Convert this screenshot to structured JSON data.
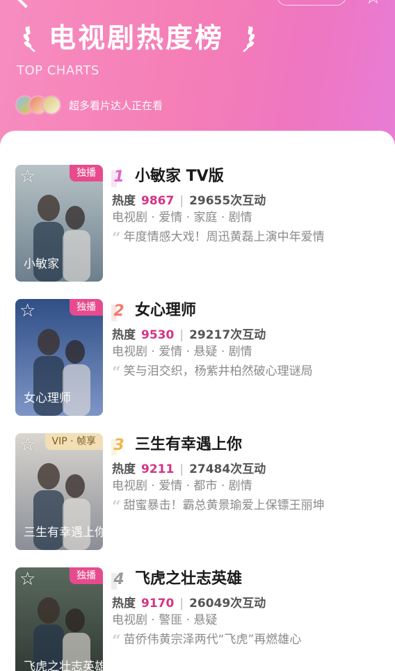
{
  "header": {
    "title": "电视剧热度榜",
    "subtitle": "TOP CHARTS",
    "viewers_text": "超多看片达人正在看",
    "star_icon": "☆"
  },
  "labels": {
    "heat": "热度",
    "interactions_suffix": "次互动"
  },
  "items": [
    {
      "rank": "1",
      "title": "小敏家 TV版",
      "badge": "独播",
      "badge_style": "pink",
      "heat": "9867",
      "interactions": "29655",
      "tags": "电视剧 · 爱情 · 家庭 · 剧情",
      "desc": "年度情感大戏！周迅黄磊上演中年爱情",
      "poster_caption": "小敏家",
      "rank_color": "#e064c9",
      "poster_colors": [
        "#b8c3c7",
        "#6c7f8c"
      ]
    },
    {
      "rank": "2",
      "title": "女心理师",
      "badge": "独播",
      "badge_style": "pink",
      "heat": "9530",
      "interactions": "29217",
      "tags": "电视剧 · 爱情 · 悬疑 · 剧情",
      "desc": "笑与泪交织，杨紫井柏然破心理谜局",
      "poster_caption": "女心理师",
      "rank_color": "#ef7b6b",
      "poster_colors": [
        "#2f4f86",
        "#7e95c6"
      ]
    },
    {
      "rank": "3",
      "title": "三生有幸遇上你",
      "badge": "VIP · 帧享",
      "badge_style": "gold",
      "heat": "9211",
      "interactions": "27484",
      "tags": "电视剧 · 爱情 · 都市 · 剧情",
      "desc": "甜蜜暴击！霸总黄景瑜爱上保镖王丽坤",
      "poster_caption": "三生有幸遇上你",
      "rank_color": "#f0b64b",
      "poster_colors": [
        "#d9d5d0",
        "#8a8f96"
      ]
    },
    {
      "rank": "4",
      "title": "飞虎之壮志英雄",
      "badge": "独播",
      "badge_style": "pink",
      "heat": "9170",
      "interactions": "26049",
      "tags": "电视剧 · 警匪 · 悬疑",
      "desc": "苗侨伟黄宗泽两代“飞虎”再燃雄心",
      "poster_caption": "飞虎之壮志英雄",
      "rank_color": "#9a9a9a",
      "poster_colors": [
        "#5a6a5e",
        "#2d3530"
      ]
    }
  ]
}
